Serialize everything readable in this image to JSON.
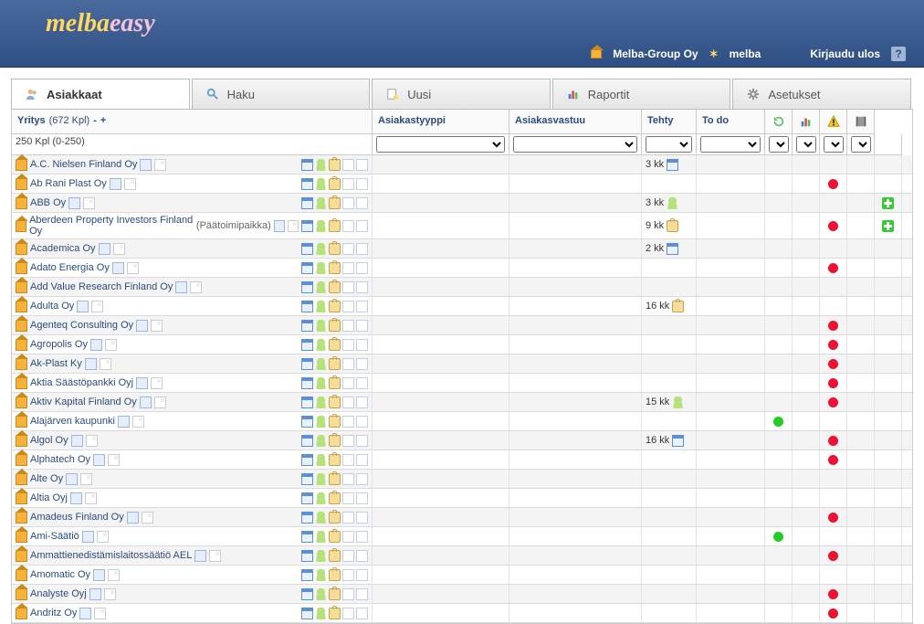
{
  "header": {
    "logo_part1": "melba",
    "logo_part2": "easy",
    "company": "Melba-Group Oy",
    "user": "melba",
    "logout": "Kirjaudu ulos"
  },
  "tabs": [
    {
      "id": "asiakkaat",
      "label": "Asiakkaat",
      "icon": "users-icon"
    },
    {
      "id": "haku",
      "label": "Haku",
      "icon": "search-icon"
    },
    {
      "id": "uusi",
      "label": "Uusi",
      "icon": "new-icon"
    },
    {
      "id": "raportit",
      "label": "Raportit",
      "icon": "chart-icon"
    },
    {
      "id": "asetukset",
      "label": "Asetukset",
      "icon": "gear-icon"
    }
  ],
  "grid": {
    "columns": {
      "yritys": "Yritys",
      "count": "(672 Kpl)",
      "asiakastyyppi": "Asiakastyyppi",
      "asiakasvastuu": "Asiakasvastuu",
      "tehty": "Tehty",
      "todo": "To do"
    },
    "page_label": "250 Kpl (0-250)",
    "collapse": "-",
    "expand": "+"
  },
  "rows": [
    {
      "name": "A.C. Nielsen Finland Oy",
      "tehty": "3 kk",
      "tehty_icon": "cal",
      "status": "",
      "plus": false
    },
    {
      "name": "Ab Rani Plast Oy",
      "tehty": "",
      "tehty_icon": "",
      "status": "red",
      "plus": false
    },
    {
      "name": "ABB Oy",
      "tehty": "3 kk",
      "tehty_icon": "person",
      "status": "",
      "plus": true
    },
    {
      "name": "Aberdeen Property Investors Finland Oy",
      "sub": "(Päätoimipaikka)",
      "tehty": "9 kk",
      "tehty_icon": "case",
      "status": "red",
      "plus": true
    },
    {
      "name": "Academica Oy",
      "tehty": "2 kk",
      "tehty_icon": "cal",
      "status": "",
      "plus": false
    },
    {
      "name": "Adato Energia Oy",
      "tehty": "",
      "tehty_icon": "",
      "status": "red",
      "plus": false
    },
    {
      "name": "Add Value Research Finland Oy",
      "tehty": "",
      "tehty_icon": "",
      "status": "",
      "plus": false
    },
    {
      "name": "Adulta Oy",
      "tehty": "16 kk",
      "tehty_icon": "case",
      "status": "",
      "plus": false
    },
    {
      "name": "Agenteq Consulting Oy",
      "tehty": "",
      "tehty_icon": "",
      "status": "red",
      "plus": false
    },
    {
      "name": "Agropolis Oy",
      "tehty": "",
      "tehty_icon": "",
      "status": "red",
      "plus": false
    },
    {
      "name": "Ak-Plast Ky",
      "tehty": "",
      "tehty_icon": "",
      "status": "red",
      "plus": false
    },
    {
      "name": "Aktia Säästöpankki Oyj",
      "tehty": "",
      "tehty_icon": "",
      "status": "red",
      "plus": false
    },
    {
      "name": "Aktiv Kapital Finland Oy",
      "tehty": "15 kk",
      "tehty_icon": "person",
      "status": "red",
      "plus": false
    },
    {
      "name": "Alajärven kaupunki",
      "tehty": "",
      "tehty_icon": "",
      "status": "green",
      "plus": false
    },
    {
      "name": "Algol Oy",
      "tehty": "16 kk",
      "tehty_icon": "cal",
      "status": "red",
      "plus": false
    },
    {
      "name": "Alphatech Oy",
      "tehty": "",
      "tehty_icon": "",
      "status": "red",
      "plus": false
    },
    {
      "name": "Alte Oy",
      "tehty": "",
      "tehty_icon": "",
      "status": "",
      "plus": false
    },
    {
      "name": "Altia Oyj",
      "tehty": "",
      "tehty_icon": "",
      "status": "",
      "plus": false
    },
    {
      "name": "Amadeus Finland Oy",
      "tehty": "",
      "tehty_icon": "",
      "status": "red",
      "plus": false
    },
    {
      "name": "Ami-Säätiö",
      "tehty": "",
      "tehty_icon": "",
      "status": "green",
      "plus": false
    },
    {
      "name": "Ammattienedistämislaitossäätiö AEL",
      "tehty": "",
      "tehty_icon": "",
      "status": "red",
      "plus": false
    },
    {
      "name": "Amomatic Oy",
      "tehty": "",
      "tehty_icon": "",
      "status": "",
      "plus": false
    },
    {
      "name": "Analyste Oyj",
      "tehty": "",
      "tehty_icon": "",
      "status": "red",
      "plus": false
    },
    {
      "name": "Andritz Oy",
      "tehty": "",
      "tehty_icon": "",
      "status": "red",
      "plus": false
    }
  ]
}
